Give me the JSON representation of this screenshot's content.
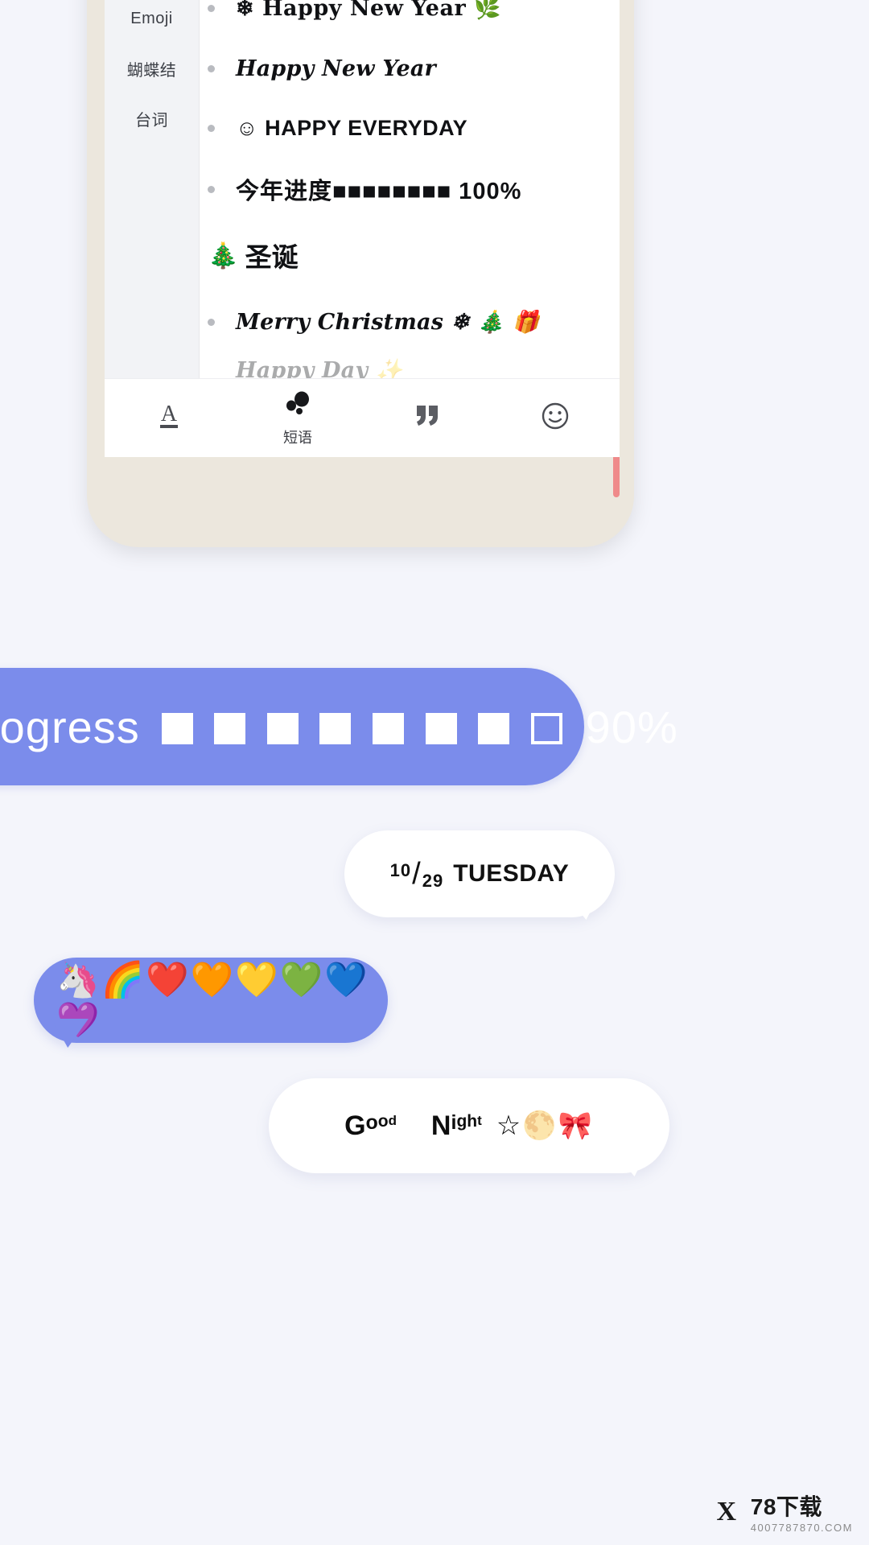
{
  "keyboard": {
    "categories": [
      {
        "label": "Emoji"
      },
      {
        "label": "蝴蝶结"
      },
      {
        "label": "台词"
      }
    ],
    "phrases": [
      {
        "id": "happy-new-year-slab",
        "text": "❄ Happy New Year 🌿",
        "style": "slab"
      },
      {
        "id": "happy-new-year-script",
        "text": "Happy New Year",
        "style": "script"
      },
      {
        "id": "happy-everyday",
        "text": "☺ HAPPY EVERYDAY",
        "style": "sans-bold"
      },
      {
        "id": "year-progress",
        "text": "今年进度■■■■■■■■ 100%",
        "style": "sans-bold"
      }
    ],
    "section_heading": {
      "emoji": "🎄",
      "label": "圣诞"
    },
    "christmas_phrases": [
      {
        "id": "merry-christmas",
        "text": "Merry Christmas ❄ 🎄 🎁",
        "style": "script"
      }
    ],
    "toolbar": [
      {
        "id": "font-style",
        "icon": "letter-A-underline-icon",
        "label": ""
      },
      {
        "id": "phrases",
        "icon": "dots-cluster-icon",
        "label": "短语"
      },
      {
        "id": "quotes",
        "icon": "quotation-mark-icon",
        "label": ""
      },
      {
        "id": "emoji",
        "icon": "smiley-face-icon",
        "label": ""
      }
    ]
  },
  "nav_bar": {
    "back": "back-triangle-icon",
    "home": "home-circle-icon",
    "recents": "recents-square-icon"
  },
  "bubbles": {
    "progress": {
      "label": "rogress",
      "filled_blocks": 7,
      "empty_blocks": 1,
      "percent": "90%",
      "color": "#7b8ceb"
    },
    "date": {
      "numerator": "10",
      "slash": "/",
      "denominator": "29",
      "weekday": "TUESDAY"
    },
    "emoji_row": {
      "text": "🦄🌈❤️🧡💛💚💙💜",
      "color": "#7b8ceb"
    },
    "good_night": {
      "word1": [
        {
          "ch": "G",
          "size": "c0"
        },
        {
          "ch": "o",
          "size": "c1"
        },
        {
          "ch": "o",
          "size": "c2"
        },
        {
          "ch": "d",
          "size": "c3"
        }
      ],
      "word2": [
        {
          "ch": "N",
          "size": "c0"
        },
        {
          "ch": "i",
          "size": "c1"
        },
        {
          "ch": "g",
          "size": "c2"
        },
        {
          "ch": "h",
          "size": "c2"
        },
        {
          "ch": "t",
          "size": "c3"
        }
      ],
      "tail_emoji": "☆🌕🎀"
    }
  },
  "watermark": {
    "logo": "X",
    "title": "78下载",
    "sub": "4007787870.COM"
  },
  "colors": {
    "page_bg": "#f4f5fb",
    "accent": "#7b8ceb",
    "phone_body": "#ece7dd",
    "nav_bar": "#e9e9e9"
  }
}
